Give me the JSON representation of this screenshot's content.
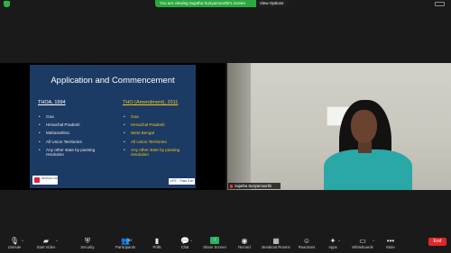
{
  "banner": {
    "viewing_text": "You are viewing Sujatha Suriyamoorthi's screen",
    "view_options": "View Options"
  },
  "slide": {
    "title": "Application and Commencement",
    "left": {
      "heading": "THOA, 1994",
      "items": [
        "Goa",
        "Himachal Pradesh",
        "Maharashtra",
        "All Union Territories",
        "Any other state by passing resolution"
      ]
    },
    "right": {
      "heading": "THO (Amendment), 2011",
      "items": [
        "Goa",
        "Himachal Pradesh",
        "West Bengal",
        "All Union Territories",
        "Any other state by passing resolution"
      ]
    },
    "logo_text": "MURAHI COLLEGE",
    "footer_tag": "LIFE... Pass it on"
  },
  "video": {
    "participant_name": "Sujatha Suriyamoorthi"
  },
  "toolbar": {
    "unmute": "Unmute",
    "start_video": "Start Video",
    "security": "Security",
    "participants": "Participants",
    "participants_count": "32",
    "polls": "Polls",
    "chat": "Chat",
    "share_screen": "Share Screen",
    "record": "Record",
    "breakout_rooms": "Breakout Rooms",
    "reactions": "Reactions",
    "apps": "Apps",
    "whiteboards": "Whiteboards",
    "more": "More",
    "end": "End"
  },
  "colors": {
    "slide_bg": "#1c3b64",
    "accent_yellow": "#f5c518",
    "zoom_green": "#2ba840",
    "end_red": "#e02828"
  }
}
